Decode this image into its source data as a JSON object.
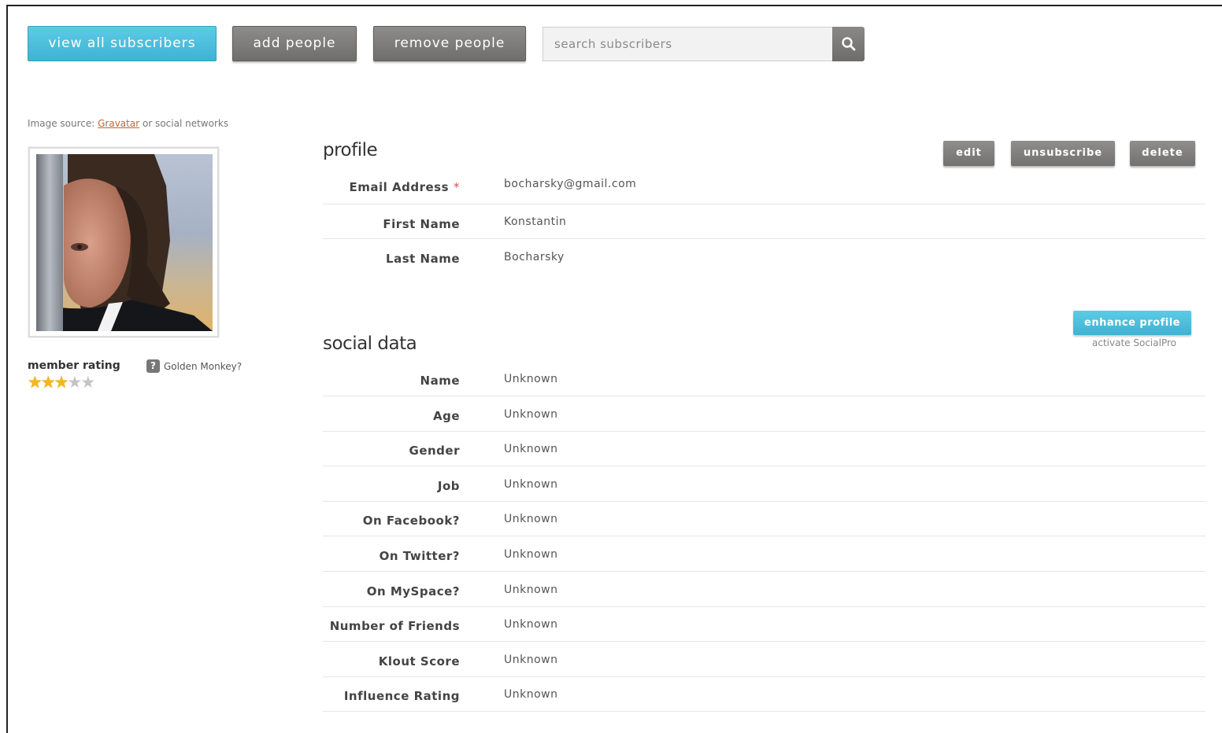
{
  "toolbar": {
    "view_all": "view all subscribers",
    "add_people": "add people",
    "remove_people": "remove people",
    "search_placeholder": "search subscribers"
  },
  "sidebar": {
    "image_source_prefix": "Image source: ",
    "image_source_link": "Gravatar",
    "image_source_suffix": " or social networks",
    "member_rating_label": "member rating",
    "rating": 3,
    "rating_max": 5,
    "help_icon": "?",
    "help_label": "Golden Monkey?"
  },
  "profile": {
    "title": "profile",
    "actions": {
      "edit": "edit",
      "unsubscribe": "unsubscribe",
      "delete": "delete"
    },
    "required_mark": "*",
    "fields": [
      {
        "label": "Email Address",
        "value": "bocharsky@gmail.com"
      },
      {
        "label": "First Name",
        "value": "Konstantin"
      },
      {
        "label": "Last Name",
        "value": "Bocharsky"
      }
    ]
  },
  "social": {
    "title": "social data",
    "enhance_label": "enhance profile",
    "activate_label": "activate SocialPro",
    "fields": [
      {
        "label": "Name",
        "value": "Unknown"
      },
      {
        "label": "Age",
        "value": "Unknown"
      },
      {
        "label": "Gender",
        "value": "Unknown"
      },
      {
        "label": "Job",
        "value": "Unknown"
      },
      {
        "label": "On Facebook?",
        "value": "Unknown"
      },
      {
        "label": "On Twitter?",
        "value": "Unknown"
      },
      {
        "label": "On MySpace?",
        "value": "Unknown"
      },
      {
        "label": "Number of Friends",
        "value": "Unknown"
      },
      {
        "label": "Klout Score",
        "value": "Unknown"
      },
      {
        "label": "Influence Rating",
        "value": "Unknown"
      }
    ]
  },
  "colors": {
    "accent": "#45b9d8",
    "button_gray": "#7a7977",
    "star": "#f3b71c"
  }
}
